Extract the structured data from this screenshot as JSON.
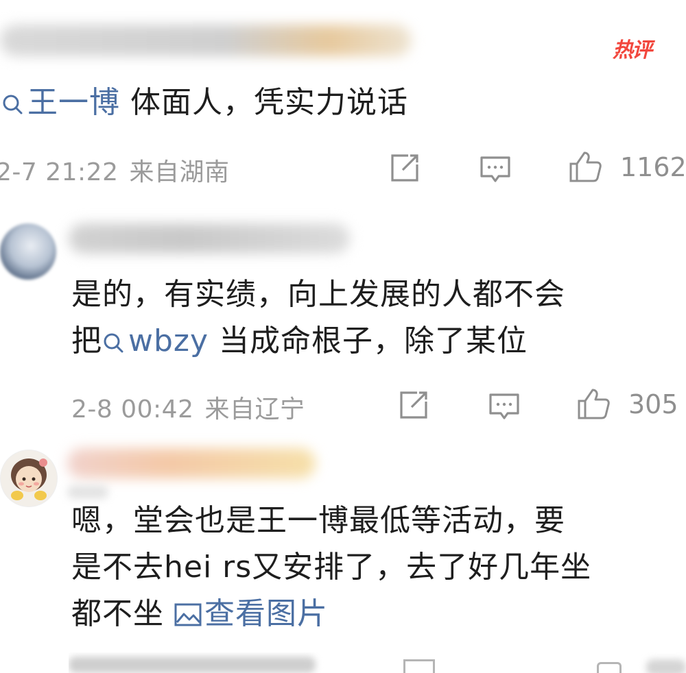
{
  "badge": {
    "hot_label": "热评"
  },
  "comments": [
    {
      "text_lines": [
        {
          "topic": "王一博",
          "rest": " 体面人，凭实力说话"
        }
      ],
      "time": "2-7 21:22",
      "location": "来自湖南",
      "likes": "1162"
    },
    {
      "text_lines": [
        {
          "plain": "是的，有实绩，向上发展的人都不会"
        },
        {
          "prefix": "把",
          "topic": "wbzy",
          "rest": " 当成命根子，除了某位"
        }
      ],
      "time": "2-8 00:42",
      "location": "来自辽宁",
      "likes": "305"
    },
    {
      "text_lines": [
        {
          "plain": "嗯，堂会也是王一博最低等活动，要"
        },
        {
          "plain": "是不去hei rs又安排了，去了好几年坐"
        },
        {
          "plain": "都不坐",
          "link": "查看图片"
        }
      ]
    }
  ],
  "colors": {
    "accent_link": "#4b6fa3",
    "hot_badge": "#f2473d",
    "meta_gray": "#9b9b9b"
  },
  "icons": [
    "search-icon",
    "share-icon",
    "comment-icon",
    "like-icon",
    "image-icon"
  ]
}
